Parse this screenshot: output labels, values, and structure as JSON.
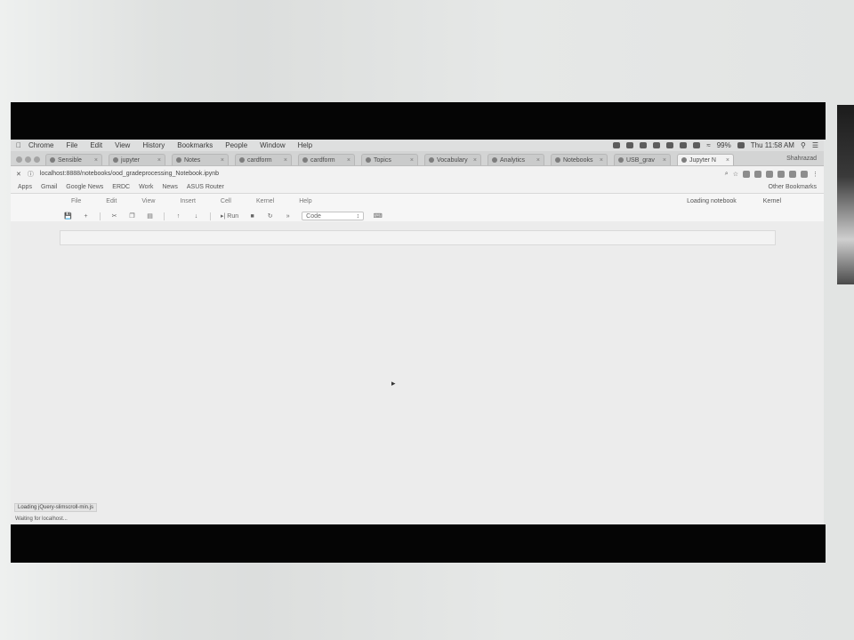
{
  "macos_menubar": {
    "apple": "",
    "items": [
      "Chrome",
      "File",
      "Edit",
      "View",
      "History",
      "Bookmarks",
      "People",
      "Window",
      "Help"
    ],
    "battery": "99%",
    "clock": "Thu 11:58 AM"
  },
  "browser": {
    "tabs": [
      {
        "label": "Sensible"
      },
      {
        "label": "jupyter"
      },
      {
        "label": "Notes"
      },
      {
        "label": "cardform"
      },
      {
        "label": "cardform"
      },
      {
        "label": "Topics"
      },
      {
        "label": "Vocabulary"
      },
      {
        "label": "Analytics"
      },
      {
        "label": "Notebooks"
      },
      {
        "label": "USB_grav"
      },
      {
        "label": "Jupyter N"
      }
    ],
    "user": "Shahrazad",
    "url": "localhost:8888/notebooks/ood_gradeprocessing_Notebook.ipynb",
    "bookmarks": [
      "Apps",
      "Gmail",
      "Google News",
      "ERDC",
      "Work",
      "News",
      "ASUS Router"
    ],
    "other_bookmarks": "Other Bookmarks"
  },
  "jupyter": {
    "menu": [
      "File",
      "Edit",
      "View",
      "Insert",
      "Cell",
      "Kernel",
      "Help"
    ],
    "status": "Loading notebook",
    "kernel": "Kernel",
    "toolbar": {
      "run_label": "Run",
      "cell_type": "Code"
    }
  },
  "status_bar": {
    "loading_url": "Loading jQuery-slimscroll-min.js",
    "waiting": "Waiting for localhost..."
  }
}
